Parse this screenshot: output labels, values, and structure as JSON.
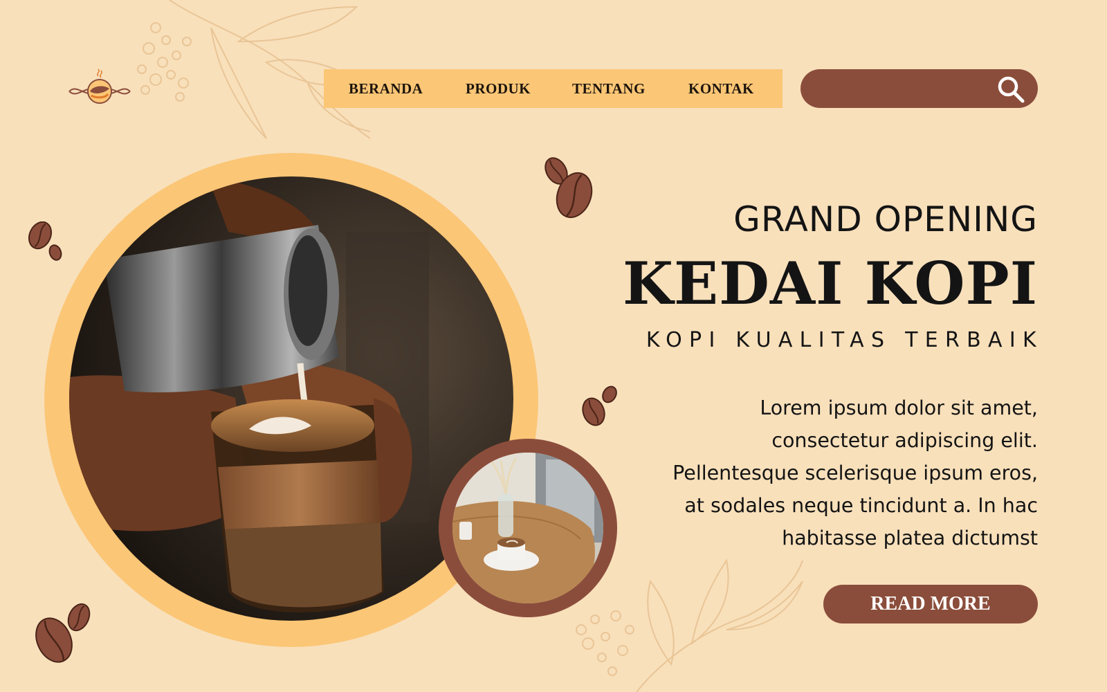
{
  "nav": {
    "items": [
      {
        "label": "BERANDA"
      },
      {
        "label": "PRODUK"
      },
      {
        "label": "TENTANG"
      },
      {
        "label": "KONTAK"
      }
    ]
  },
  "search": {
    "placeholder": "",
    "icon": "search-icon"
  },
  "hero": {
    "kicker": "GRAND OPENING",
    "title": "KEDAI KOPI",
    "tagline": "KOPI KUALITAS TERBAIK",
    "body": "Lorem ipsum dolor sit amet, consectetur adipiscing elit. Pellentesque scelerisque ipsum eros, at sodales neque tincidunt a. In hac habitasse platea dictumst",
    "cta": "READ MORE"
  },
  "colors": {
    "background": "#f8e0bb",
    "accent_yellow": "#fbc676",
    "accent_brown": "#8b4d3b",
    "text": "#141414"
  }
}
